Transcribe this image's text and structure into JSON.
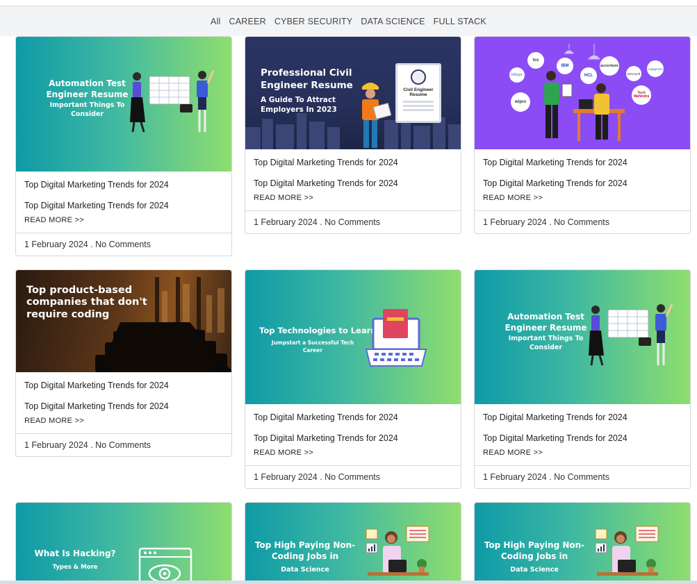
{
  "filters": [
    "All",
    "CAREER",
    "CYBER SECURITY",
    "DATA SCIENCE",
    "FULL STACK"
  ],
  "cards": [
    {
      "thumb": {
        "line1": "Automation Test",
        "line2": "Engineer Resume",
        "line3": "Important Things To",
        "line4": "Consider"
      },
      "title1": "Top Digital Marketing Trends for 2024",
      "title2": "Top Digital Marketing Trends for 2024",
      "more": "READ MORE >>",
      "meta": "1 February 2024 . No Comments"
    },
    {
      "thumb": {
        "line1": "Professional Civil",
        "line2": "Engineer Resume",
        "line3": "A Guide To Attract",
        "line4": "Employers In 2023",
        "doc": "Civil Engineer Resume"
      },
      "title1": "Top Digital Marketing Trends for 2024",
      "title2": "Top Digital Marketing Trends for 2024",
      "more": "READ MORE >>",
      "meta": "1 February 2024 . No Comments"
    },
    {
      "thumb": {
        "logos": [
          "tcs",
          "IBM",
          "HCL",
          "accenture",
          "Microsoft",
          "Capgemini",
          "Tech Mahindra",
          "wipro",
          "Infosys"
        ]
      },
      "title1": "Top Digital Marketing Trends for 2024",
      "title2": "Top Digital Marketing Trends for 2024",
      "more": "READ MORE >>",
      "meta": "1 February 2024 . No Comments"
    },
    {
      "thumb": {
        "line1": "Top product-based",
        "line2": "companies that don't",
        "line3": "require coding"
      },
      "title1": "Top Digital Marketing Trends for 2024",
      "title2": "Top Digital Marketing Trends for 2024",
      "more": "READ MORE >>",
      "meta": "1 February 2024 . No Comments"
    },
    {
      "thumb": {
        "line1": "Top Technologies to Learn",
        "line2": "Jumpstart a Successful Tech",
        "line3": "Career"
      },
      "title1": "Top Digital Marketing Trends for 2024",
      "title2": "Top Digital Marketing Trends for 2024",
      "more": "READ MORE >>",
      "meta": "1 February 2024 . No Comments"
    },
    {
      "thumb": {
        "line1": "Automation Test",
        "line2": "Engineer Resume",
        "line3": "Important Things To",
        "line4": "Consider"
      },
      "title1": "Top Digital Marketing Trends for 2024",
      "title2": "Top Digital Marketing Trends for 2024",
      "more": "READ MORE >>",
      "meta": "1 February 2024 . No Comments"
    },
    {
      "thumb": {
        "line1": "What Is Hacking?",
        "line2": "Types & More"
      }
    },
    {
      "thumb": {
        "line1": "Top High Paying Non-",
        "line2": "Coding Jobs in",
        "line3": "Data Science"
      }
    },
    {
      "thumb": {
        "line1": "Top High Paying Non-",
        "line2": "Coding Jobs in",
        "line3": "Data Science"
      }
    }
  ],
  "colors": {
    "teal_start": "#0e9aa7",
    "green_end": "#8fde6e",
    "purple": "#8b4cf5",
    "navy": "#2b3563"
  }
}
